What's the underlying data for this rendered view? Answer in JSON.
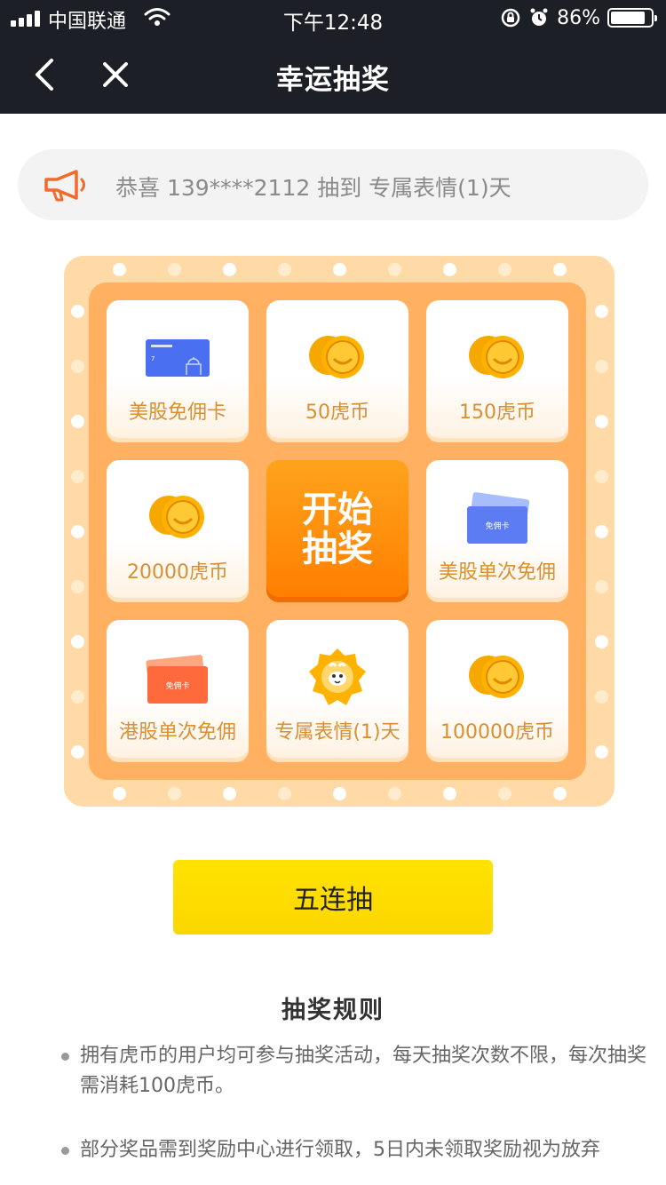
{
  "status_bar": {
    "carrier": "中国联通",
    "time": "下午12:48",
    "battery": "86%",
    "battery_level": 0.86
  },
  "nav": {
    "title": "幸运抽奖"
  },
  "notice": {
    "text": "恭喜 139****2112 抽到 专属表情(1)天"
  },
  "lottery": {
    "start_label": "开始\n抽奖",
    "prizes": [
      {
        "label": "美股免佣卡",
        "icon": "us-stock-card-icon"
      },
      {
        "label": "50虎币",
        "icon": "coins-icon"
      },
      {
        "label": "150虎币",
        "icon": "coins-icon"
      },
      {
        "label": "20000虎币",
        "icon": "coins-icon"
      },
      {
        "label": "美股单次免佣",
        "icon": "commission-free-card-blue-icon",
        "card_text": "免佣卡"
      },
      {
        "label": "港股单次免佣",
        "icon": "commission-free-card-red-icon",
        "card_text": "免佣卡"
      },
      {
        "label": "专属表情(1)天",
        "icon": "emoji-badge-icon"
      },
      {
        "label": "100000虎币",
        "icon": "coins-icon"
      }
    ]
  },
  "five_draw": {
    "label": "五连抽"
  },
  "rules": {
    "title": "抽奖规则",
    "items": [
      "拥有虎币的用户均可参与抽奖活动，每天抽奖次数不限，每次抽奖需消耗100虎币。",
      "部分奖品需到奖励中心进行领取，5日内未领取奖励视为放弃"
    ]
  },
  "colors": {
    "nav_bg": "#1d1f26",
    "board_outer": "#ffd9a6",
    "board_inner": "#ffb060",
    "prize_text": "#d98f32",
    "start_button": "#ff8a00",
    "five_button": "#ffe000"
  }
}
